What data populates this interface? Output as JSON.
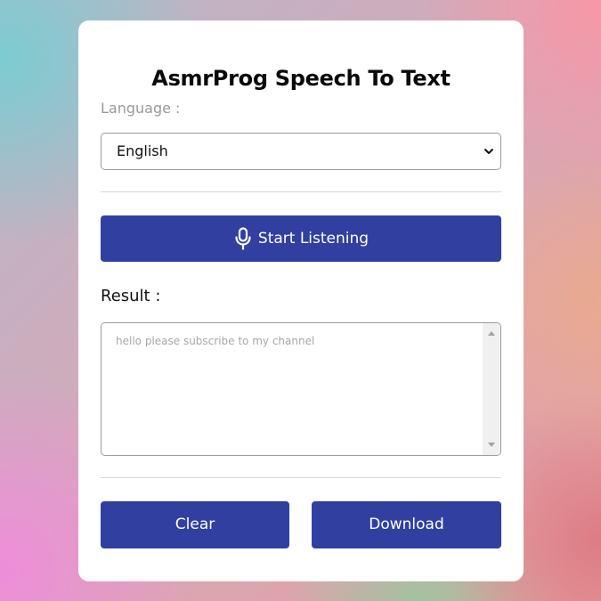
{
  "app": {
    "title": "AsmrProg Speech To Text"
  },
  "language": {
    "label": "Language :",
    "selected": "English"
  },
  "listen_button": {
    "label": "Start Listening",
    "icon": "microphone-icon"
  },
  "result": {
    "label": "Result :",
    "placeholder": "hello please subscribe to my channel"
  },
  "actions": {
    "clear_label": "Clear",
    "download_label": "Download"
  },
  "colors": {
    "accent": "#3140a0",
    "card": "#ffffff",
    "muted_label": "#9a9a9a"
  }
}
